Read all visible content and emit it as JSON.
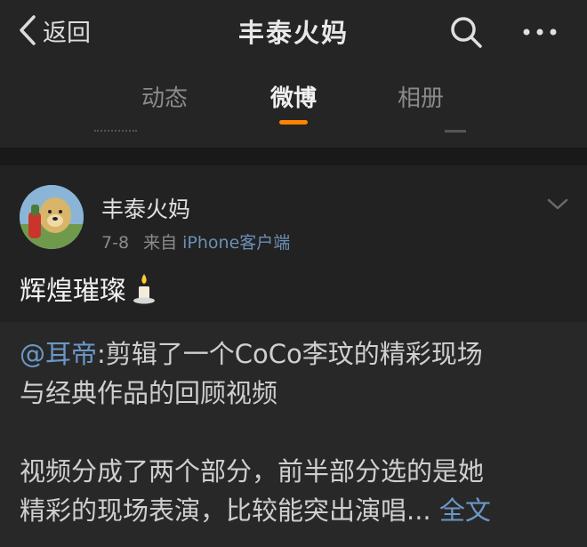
{
  "nav": {
    "back_label": "返回",
    "title": "丰泰火妈"
  },
  "tabs": [
    {
      "label": "动态",
      "active": false
    },
    {
      "label": "微博",
      "active": true
    },
    {
      "label": "相册",
      "active": false
    }
  ],
  "colors": {
    "accent": "#ff8200",
    "link": "#6b98c8"
  },
  "post": {
    "username": "丰泰火妈",
    "date": "7-8",
    "from_prefix": "来自",
    "source": "iPhone客户端",
    "text": "辉煌璀璨",
    "emoji": "candle-icon"
  },
  "repost": {
    "mention": "@耳帝",
    "line1_rest": ":剪辑了一个CoCo李玟的精彩现场",
    "line2": "与经典作品的回顾视频",
    "line3": "视频分成了两个部分，前半部分选的是她",
    "line4": "精彩的现场表演，比较能突出演唱...",
    "full_text_link": "全文"
  }
}
